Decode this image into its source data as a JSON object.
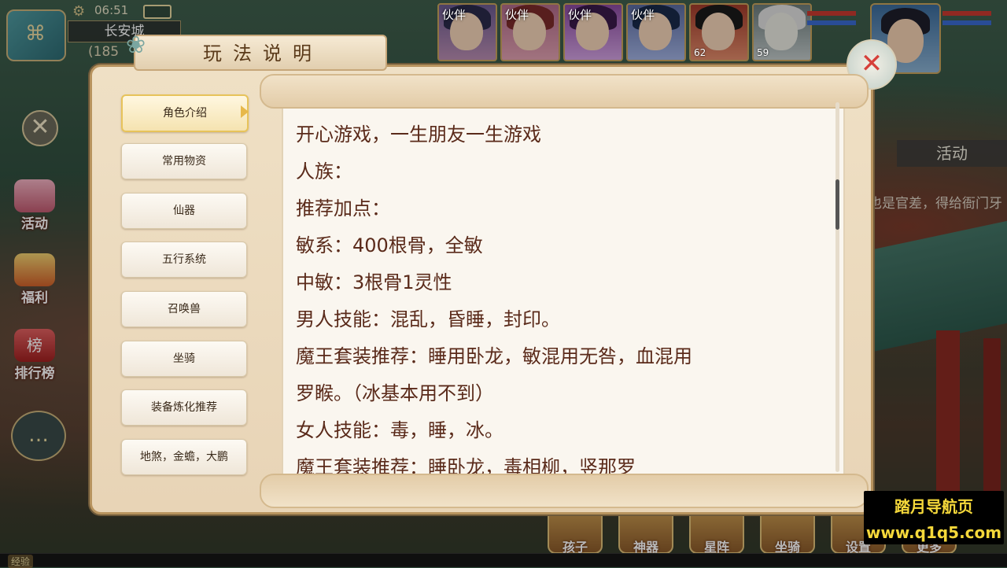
{
  "hud": {
    "clock": "06:51",
    "location": "长安城",
    "coords": "(185",
    "partners": [
      {
        "tag": "伙伴",
        "level": ""
      },
      {
        "tag": "伙伴",
        "level": ""
      },
      {
        "tag": "伙伴",
        "level": ""
      },
      {
        "tag": "伙伴",
        "level": ""
      },
      {
        "tag": "",
        "level": "62"
      },
      {
        "tag": "",
        "level": "59"
      }
    ]
  },
  "side_menu": {
    "activity": "活动",
    "welfare": "福利",
    "rank": "排行榜",
    "rank_icon": "榜"
  },
  "right_panel": {
    "tab": "活动",
    "text": "也是官差，得给衙门牙"
  },
  "bottom_buttons": [
    "孩子",
    "神器",
    "星阵",
    "坐骑",
    "设置",
    "更多"
  ],
  "bottom_bar": {
    "exp": "经验"
  },
  "watermark": {
    "line1": "踏月导航页",
    "line2": "www.q1q5.com"
  },
  "dialog": {
    "title": "玩法说明",
    "tabs": [
      "角色介绍",
      "常用物资",
      "仙器",
      "五行系统",
      "召唤兽",
      "坐骑",
      "装备炼化推荐",
      "地煞，金蟾，大鹏"
    ],
    "active_tab": 0,
    "content_lines": [
      "开心游戏，一生朋友一生游戏",
      "人族：",
      "推荐加点：",
      "敏系：400根骨，全敏",
      "中敏：3根骨1灵性",
      "男人技能：混乱，昏睡，封印。",
      "魔王套装推荐：睡用卧龙，敏混用无咎，血混用",
      "罗睺。（冰基本用不到）",
      "女人技能：毒，睡，冰。",
      "魔王套装推荐：睡卧龙，毒相柳，竖那罗"
    ]
  }
}
